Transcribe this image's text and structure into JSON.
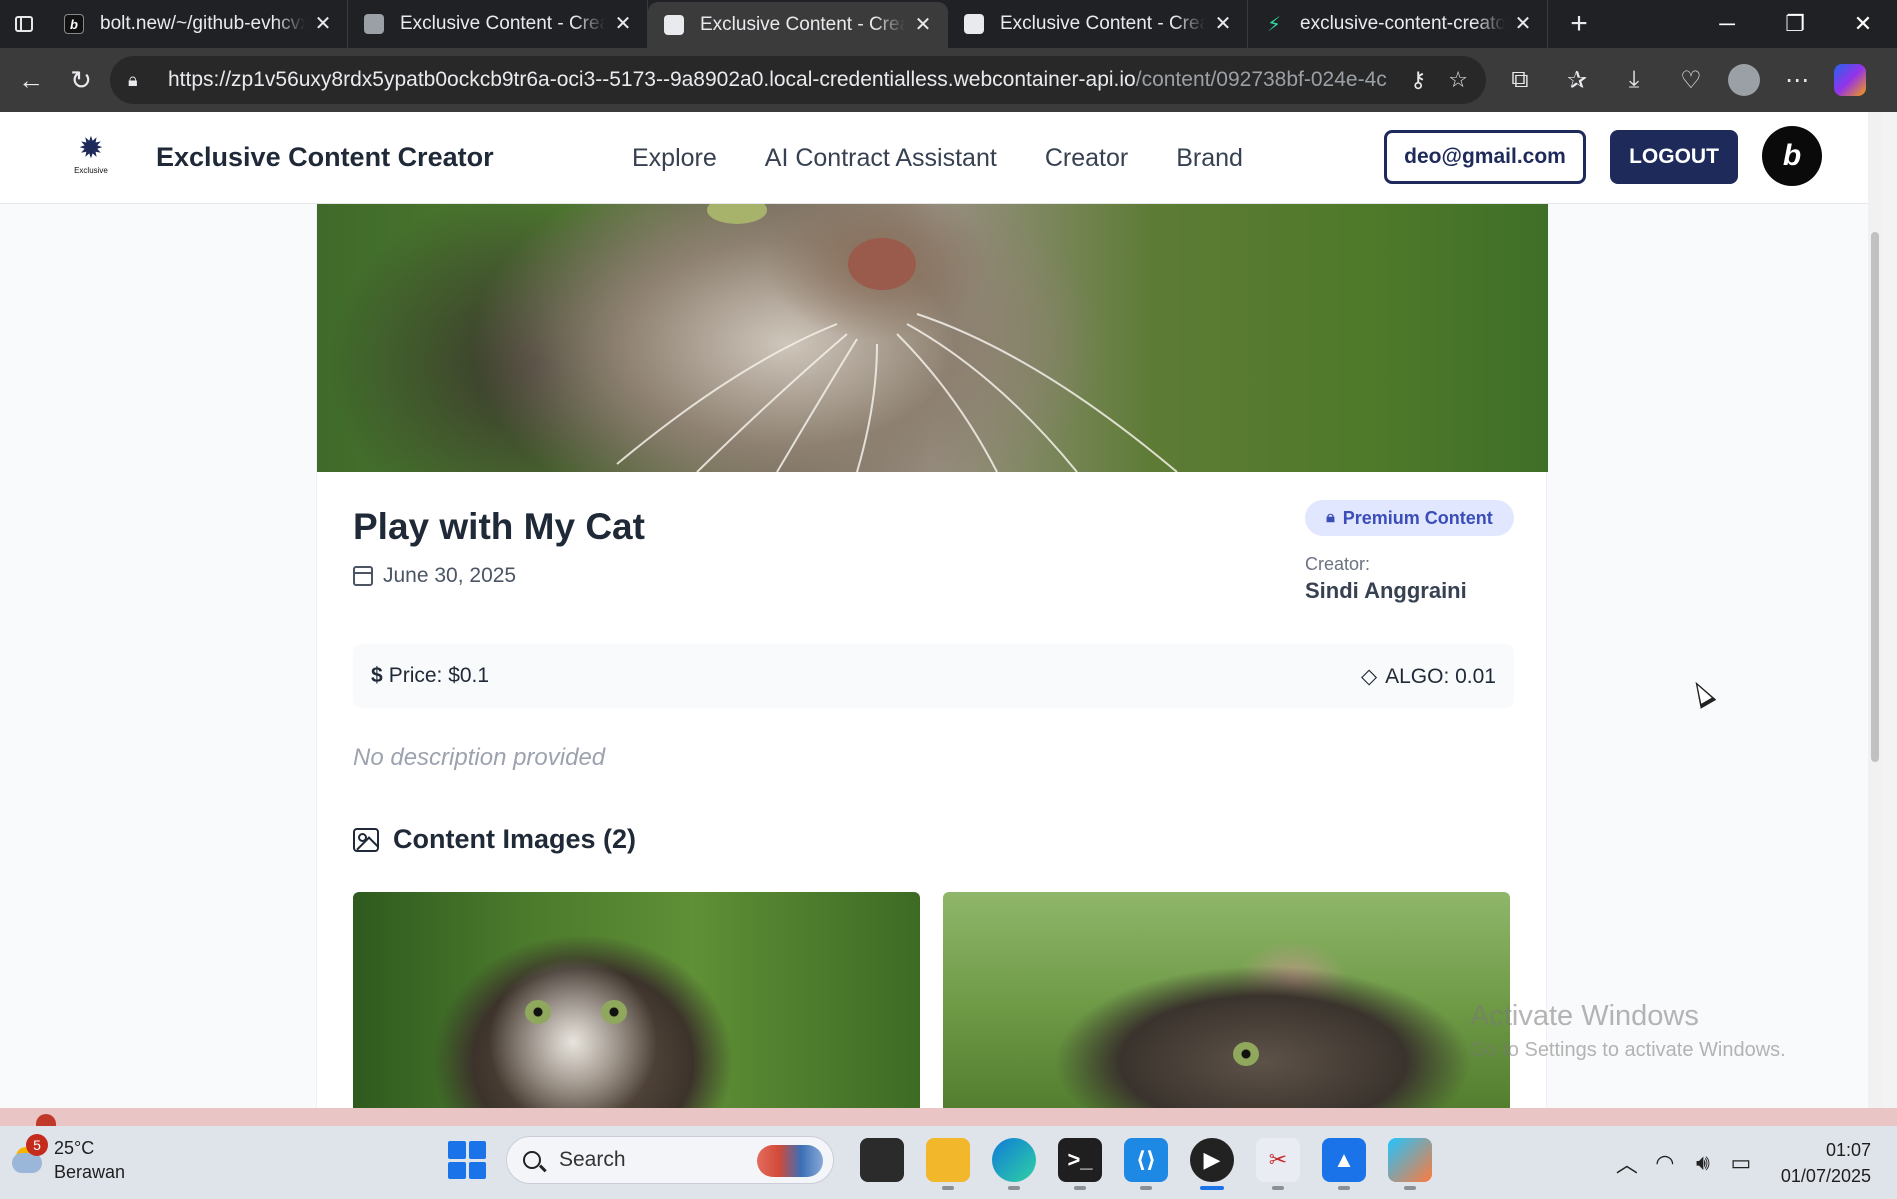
{
  "browser": {
    "tabs": [
      {
        "title": "bolt.new/~/github-evhcvx",
        "favicon": "bolt-icon",
        "active": false
      },
      {
        "title": "Exclusive Content - Creator",
        "favicon": "page-icon",
        "active": false
      },
      {
        "title": "Exclusive Content - Creator",
        "favicon": "page-icon",
        "active": true
      },
      {
        "title": "Exclusive Content - Creator",
        "favicon": "page-icon",
        "active": false
      },
      {
        "title": "exclusive-content-creator",
        "favicon": "bolt-green-icon",
        "active": false
      }
    ],
    "url_main": "https://zp1v56uxy8rdx5ypatb0ockcb9tr6a-oci3--5173--9a8902a0.local-credentialless.webcontainer-api.io",
    "url_path": "/content/092738bf-024e-4c..."
  },
  "app": {
    "brand": "Exclusive Content Creator",
    "logo_word": "Exclusive",
    "nav": [
      "Explore",
      "AI Contract Assistant",
      "Creator",
      "Brand"
    ],
    "user_email": "deo@gmail.com",
    "logout_label": "LOGOUT",
    "badge_letter": "b"
  },
  "content": {
    "title": "Play with My Cat",
    "date": "June 30, 2025",
    "premium_label": "Premium Content",
    "creator_label": "Creator:",
    "creator_name": "Sindi Anggraini",
    "price_label": "Price: $0.1",
    "algo_label": "ALGO: 0.01",
    "description": "No description provided",
    "images_heading": "Content Images (2)"
  },
  "watermark": {
    "line1": "Activate Windows",
    "line2": "Go to Settings to activate Windows."
  },
  "taskbar": {
    "weather_badge": "5",
    "temperature": "25°C",
    "weather_desc": "Berawan",
    "search_placeholder": "Search",
    "time": "01:07",
    "date": "01/07/2025"
  },
  "colors": {
    "primary": "#1e2a5a",
    "premium_bg": "#e0e7ff",
    "premium_text": "#3b4db8"
  }
}
